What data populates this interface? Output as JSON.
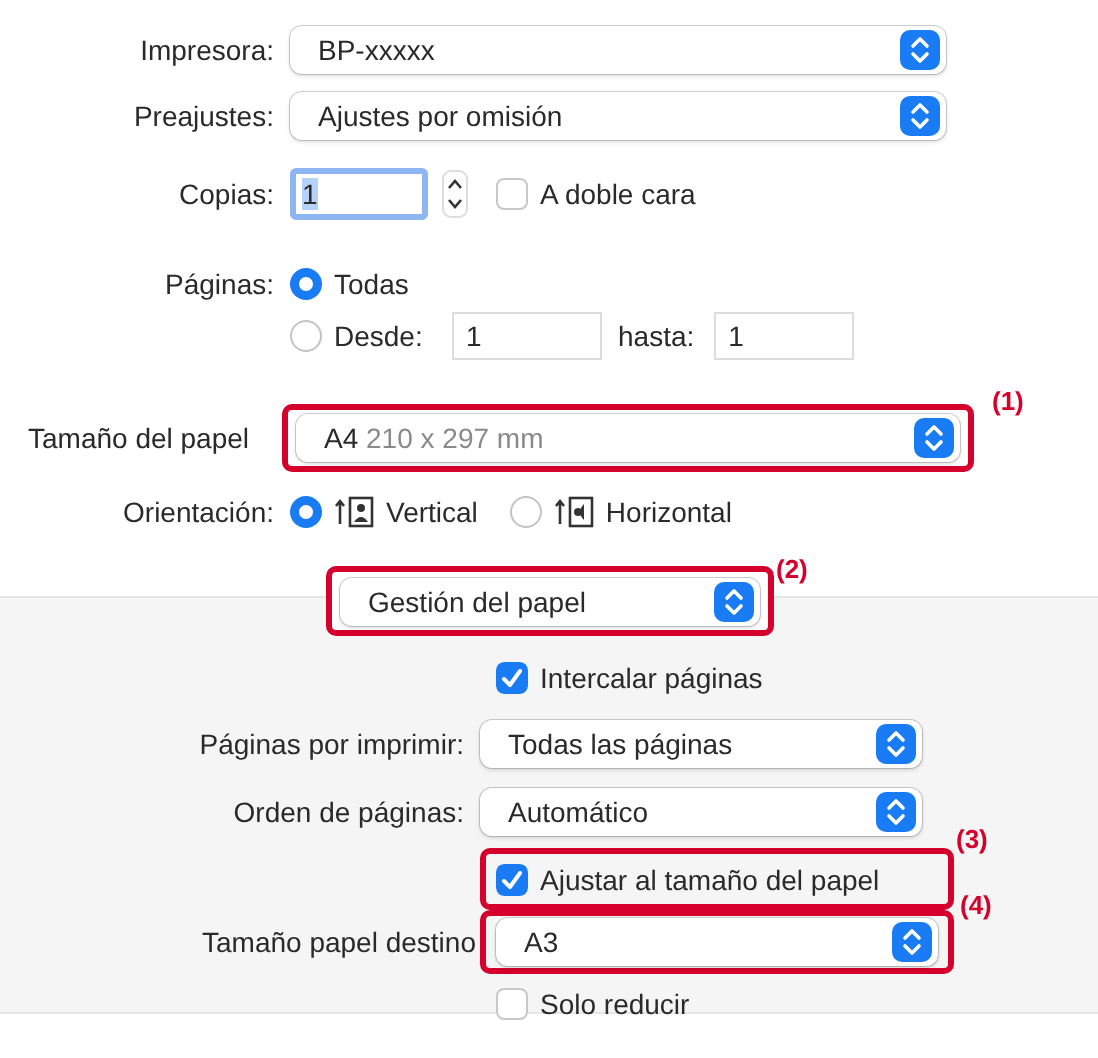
{
  "printer": {
    "label": "Impresora:",
    "value": "BP-xxxxx"
  },
  "presets": {
    "label": "Preajustes:",
    "value": "Ajustes por omisión"
  },
  "copies": {
    "label": "Copias:",
    "value": "1",
    "two_sided": {
      "label": "A doble cara",
      "checked": false
    }
  },
  "pages": {
    "label": "Páginas:",
    "options": [
      {
        "label": "Todas",
        "selected": true
      },
      {
        "label": "Desde:",
        "selected": false
      }
    ],
    "from": "1",
    "to_label": "hasta:",
    "to": "1"
  },
  "paper_size": {
    "label": "Tamaño del papel",
    "size": "A4",
    "dimensions": "210 x 297 mm",
    "callout": "(1)"
  },
  "orientation": {
    "label": "Orientación:",
    "options": [
      {
        "label": "Vertical",
        "selected": true
      },
      {
        "label": "Horizontal",
        "selected": false
      }
    ]
  },
  "section_menu": {
    "value": "Gestión del papel",
    "callout": "(2)"
  },
  "paper_handling": {
    "collate": {
      "label": "Intercalar páginas",
      "checked": true
    },
    "pages_to_print": {
      "label": "Páginas por imprimir:",
      "value": "Todas las páginas"
    },
    "page_order": {
      "label": "Orden de páginas:",
      "value": "Automático"
    },
    "scale_to_fit": {
      "label": "Ajustar al tamaño del papel",
      "checked": true,
      "callout": "(3)"
    },
    "destination": {
      "label": "Tamaño papel destino",
      "value": "A3",
      "callout": "(4)"
    },
    "scale_down_only": {
      "label": "Solo reducir",
      "checked": false
    }
  }
}
